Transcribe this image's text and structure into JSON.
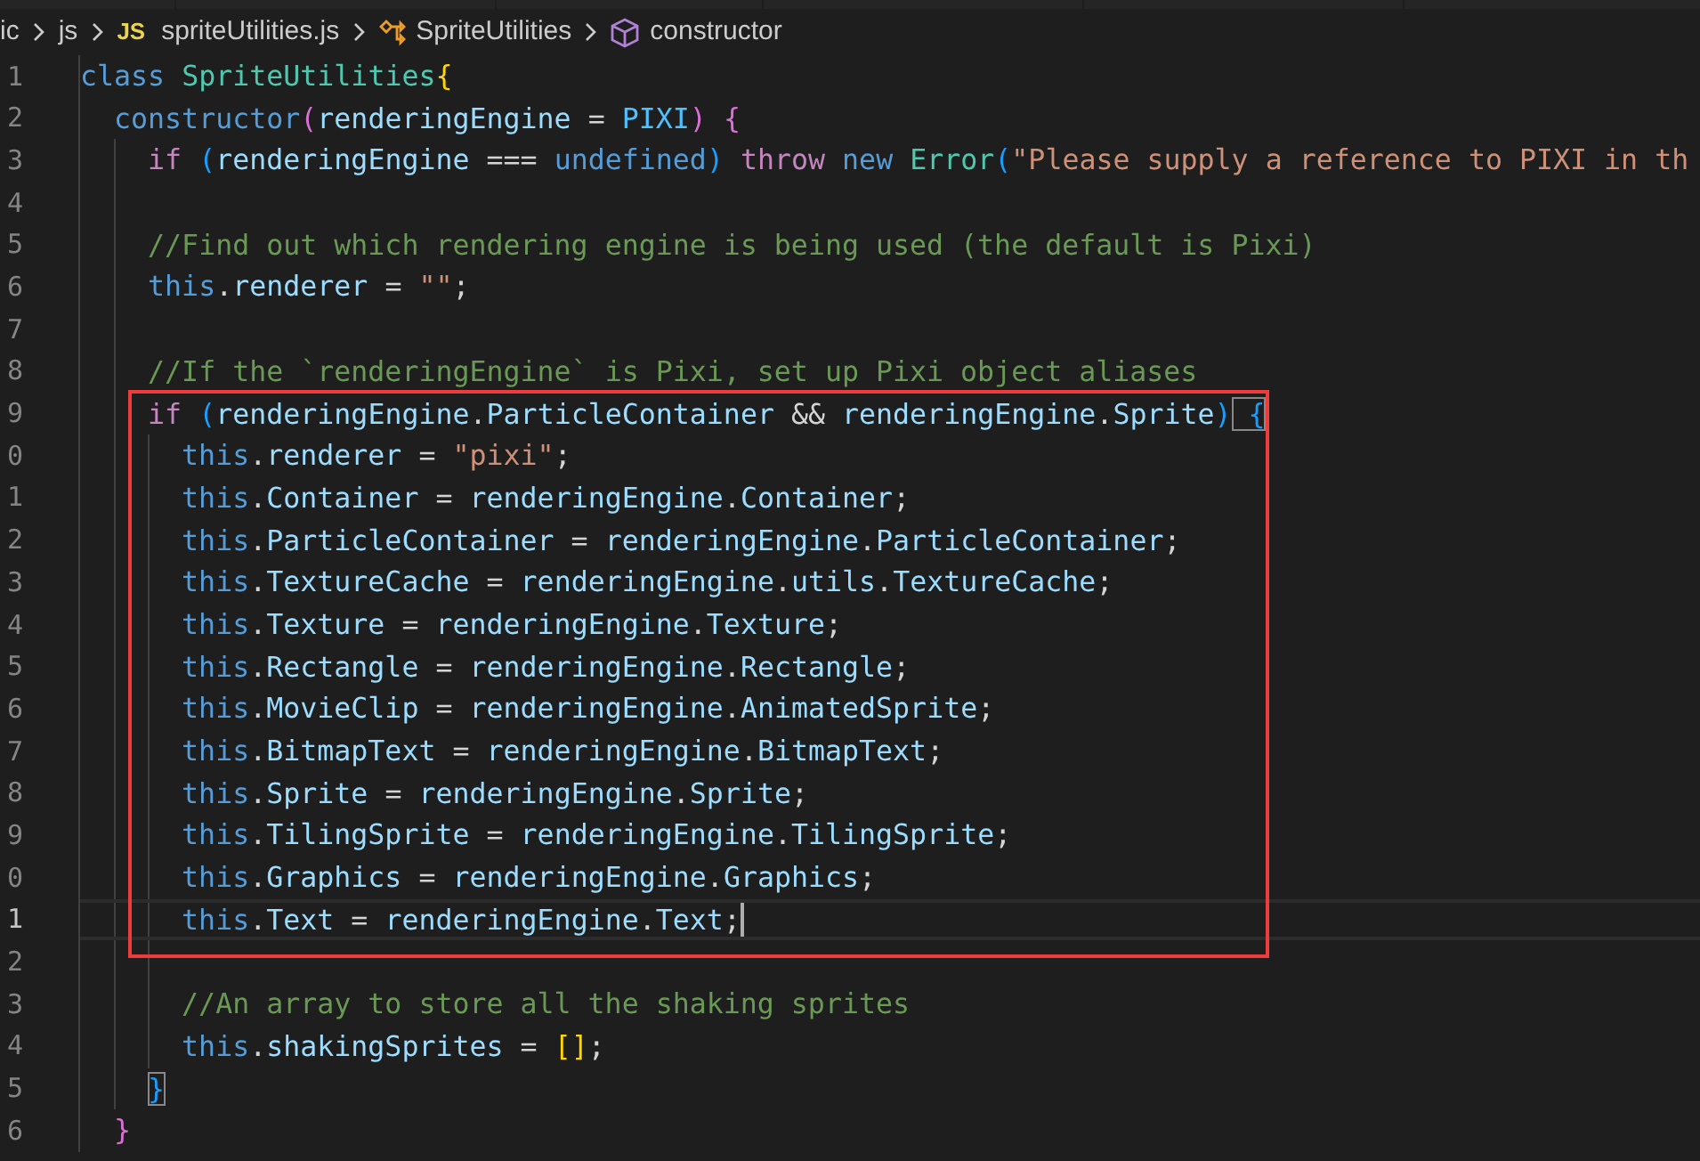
{
  "breadcrumb": {
    "segments": [
      {
        "kind": "folder",
        "text": "ic"
      },
      {
        "kind": "folder",
        "text": "js"
      },
      {
        "kind": "file",
        "badge": "JS",
        "text": "spriteUtilities.js"
      },
      {
        "kind": "class",
        "text": "SpriteUtilities"
      },
      {
        "kind": "method",
        "text": "constructor"
      }
    ]
  },
  "editor": {
    "lines": [
      {
        "number": "1",
        "current": false,
        "tokens": [
          {
            "kind": "kw",
            "text": "class"
          },
          {
            "kind": "cls",
            "text": " SpriteUtilities"
          },
          {
            "kind": "b1",
            "text": "{",
            "matched": false
          }
        ]
      },
      {
        "number": "2",
        "current": false,
        "tokens": [
          {
            "kind": "kw",
            "text": "  constructor"
          },
          {
            "kind": "b2",
            "text": "(",
            "matched": false
          },
          {
            "kind": "var",
            "text": "renderingEngine"
          },
          {
            "kind": "op",
            "text": " = "
          },
          {
            "kind": "const",
            "text": "PIXI"
          },
          {
            "kind": "b2",
            "text": ")",
            "matched": false
          },
          {
            "kind": "b2",
            "text": " {",
            "matched": false
          }
        ]
      },
      {
        "number": "3",
        "current": false,
        "tokens": [
          {
            "kind": "ctl",
            "text": "    if"
          },
          {
            "kind": "b3",
            "text": " (",
            "matched": false
          },
          {
            "kind": "var",
            "text": "renderingEngine"
          },
          {
            "kind": "op",
            "text": " === "
          },
          {
            "kind": "kw",
            "text": "undefined"
          },
          {
            "kind": "b3",
            "text": ")",
            "matched": false
          },
          {
            "kind": "ctl",
            "text": " throw"
          },
          {
            "kind": "kw",
            "text": " new"
          },
          {
            "kind": "cls",
            "text": " Error"
          },
          {
            "kind": "b3",
            "text": "(",
            "matched": false
          },
          {
            "kind": "str",
            "text": "\"Please supply a reference to PIXI in th"
          }
        ]
      },
      {
        "number": "4",
        "current": false
      },
      {
        "number": "5",
        "current": false,
        "tokens": [
          {
            "kind": "cmt",
            "text": "    //Find out which rendering engine is being used (the default is Pixi)"
          }
        ]
      },
      {
        "number": "6",
        "current": false,
        "tokens": [
          {
            "kind": "kw",
            "text": "    this"
          },
          {
            "kind": "op",
            "text": "."
          },
          {
            "kind": "var",
            "text": "renderer"
          },
          {
            "kind": "op",
            "text": " = "
          },
          {
            "kind": "str",
            "text": "\"\""
          },
          {
            "kind": "op",
            "text": ";"
          }
        ]
      },
      {
        "number": "7",
        "current": false
      },
      {
        "number": "8",
        "current": false,
        "tokens": [
          {
            "kind": "cmt",
            "text": "    //If the `renderingEngine` is Pixi, set up Pixi object aliases"
          }
        ]
      },
      {
        "number": "9",
        "current": false,
        "tokens": [
          {
            "kind": "ctl",
            "text": "    if"
          },
          {
            "kind": "b3",
            "text": " (",
            "matched": false
          },
          {
            "kind": "var",
            "text": "renderingEngine"
          },
          {
            "kind": "op",
            "text": "."
          },
          {
            "kind": "var",
            "text": "ParticleContainer"
          },
          {
            "kind": "op",
            "text": " && "
          },
          {
            "kind": "var",
            "text": "renderingEngine"
          },
          {
            "kind": "op",
            "text": "."
          },
          {
            "kind": "var",
            "text": "Sprite"
          },
          {
            "kind": "b3",
            "text": ")",
            "matched": false
          },
          {
            "kind": "b3",
            "text": " {",
            "matched": true
          }
        ]
      },
      {
        "number": "0",
        "current": false,
        "tokens": [
          {
            "kind": "kw",
            "text": "      this"
          },
          {
            "kind": "op",
            "text": "."
          },
          {
            "kind": "var",
            "text": "renderer"
          },
          {
            "kind": "op",
            "text": " = "
          },
          {
            "kind": "str",
            "text": "\"pixi\""
          },
          {
            "kind": "op",
            "text": ";"
          }
        ]
      },
      {
        "number": "1",
        "current": false,
        "tokens": [
          {
            "kind": "kw",
            "text": "      this"
          },
          {
            "kind": "op",
            "text": "."
          },
          {
            "kind": "var",
            "text": "Container"
          },
          {
            "kind": "op",
            "text": " = "
          },
          {
            "kind": "var",
            "text": "renderingEngine"
          },
          {
            "kind": "op",
            "text": "."
          },
          {
            "kind": "var",
            "text": "Container"
          },
          {
            "kind": "op",
            "text": ";"
          }
        ]
      },
      {
        "number": "2",
        "current": false,
        "tokens": [
          {
            "kind": "kw",
            "text": "      this"
          },
          {
            "kind": "op",
            "text": "."
          },
          {
            "kind": "var",
            "text": "ParticleContainer"
          },
          {
            "kind": "op",
            "text": " = "
          },
          {
            "kind": "var",
            "text": "renderingEngine"
          },
          {
            "kind": "op",
            "text": "."
          },
          {
            "kind": "var",
            "text": "ParticleContainer"
          },
          {
            "kind": "op",
            "text": ";"
          }
        ]
      },
      {
        "number": "3",
        "current": false,
        "tokens": [
          {
            "kind": "kw",
            "text": "      this"
          },
          {
            "kind": "op",
            "text": "."
          },
          {
            "kind": "var",
            "text": "TextureCache"
          },
          {
            "kind": "op",
            "text": " = "
          },
          {
            "kind": "var",
            "text": "renderingEngine"
          },
          {
            "kind": "op",
            "text": "."
          },
          {
            "kind": "var",
            "text": "utils"
          },
          {
            "kind": "op",
            "text": "."
          },
          {
            "kind": "var",
            "text": "TextureCache"
          },
          {
            "kind": "op",
            "text": ";"
          }
        ]
      },
      {
        "number": "4",
        "current": false,
        "tokens": [
          {
            "kind": "kw",
            "text": "      this"
          },
          {
            "kind": "op",
            "text": "."
          },
          {
            "kind": "var",
            "text": "Texture"
          },
          {
            "kind": "op",
            "text": " = "
          },
          {
            "kind": "var",
            "text": "renderingEngine"
          },
          {
            "kind": "op",
            "text": "."
          },
          {
            "kind": "var",
            "text": "Texture"
          },
          {
            "kind": "op",
            "text": ";"
          }
        ]
      },
      {
        "number": "5",
        "current": false,
        "tokens": [
          {
            "kind": "kw",
            "text": "      this"
          },
          {
            "kind": "op",
            "text": "."
          },
          {
            "kind": "var",
            "text": "Rectangle"
          },
          {
            "kind": "op",
            "text": " = "
          },
          {
            "kind": "var",
            "text": "renderingEngine"
          },
          {
            "kind": "op",
            "text": "."
          },
          {
            "kind": "var",
            "text": "Rectangle"
          },
          {
            "kind": "op",
            "text": ";"
          }
        ]
      },
      {
        "number": "6",
        "current": false,
        "tokens": [
          {
            "kind": "kw",
            "text": "      this"
          },
          {
            "kind": "op",
            "text": "."
          },
          {
            "kind": "var",
            "text": "MovieClip"
          },
          {
            "kind": "op",
            "text": " = "
          },
          {
            "kind": "var",
            "text": "renderingEngine"
          },
          {
            "kind": "op",
            "text": "."
          },
          {
            "kind": "var",
            "text": "AnimatedSprite"
          },
          {
            "kind": "op",
            "text": ";"
          }
        ]
      },
      {
        "number": "7",
        "current": false,
        "tokens": [
          {
            "kind": "kw",
            "text": "      this"
          },
          {
            "kind": "op",
            "text": "."
          },
          {
            "kind": "var",
            "text": "BitmapText"
          },
          {
            "kind": "op",
            "text": " = "
          },
          {
            "kind": "var",
            "text": "renderingEngine"
          },
          {
            "kind": "op",
            "text": "."
          },
          {
            "kind": "var",
            "text": "BitmapText"
          },
          {
            "kind": "op",
            "text": ";"
          }
        ]
      },
      {
        "number": "8",
        "current": false,
        "tokens": [
          {
            "kind": "kw",
            "text": "      this"
          },
          {
            "kind": "op",
            "text": "."
          },
          {
            "kind": "var",
            "text": "Sprite"
          },
          {
            "kind": "op",
            "text": " = "
          },
          {
            "kind": "var",
            "text": "renderingEngine"
          },
          {
            "kind": "op",
            "text": "."
          },
          {
            "kind": "var",
            "text": "Sprite"
          },
          {
            "kind": "op",
            "text": ";"
          }
        ]
      },
      {
        "number": "9",
        "current": false,
        "tokens": [
          {
            "kind": "kw",
            "text": "      this"
          },
          {
            "kind": "op",
            "text": "."
          },
          {
            "kind": "var",
            "text": "TilingSprite"
          },
          {
            "kind": "op",
            "text": " = "
          },
          {
            "kind": "var",
            "text": "renderingEngine"
          },
          {
            "kind": "op",
            "text": "."
          },
          {
            "kind": "var",
            "text": "TilingSprite"
          },
          {
            "kind": "op",
            "text": ";"
          }
        ]
      },
      {
        "number": "0",
        "current": false,
        "tokens": [
          {
            "kind": "kw",
            "text": "      this"
          },
          {
            "kind": "op",
            "text": "."
          },
          {
            "kind": "var",
            "text": "Graphics"
          },
          {
            "kind": "op",
            "text": " = "
          },
          {
            "kind": "var",
            "text": "renderingEngine"
          },
          {
            "kind": "op",
            "text": "."
          },
          {
            "kind": "var",
            "text": "Graphics"
          },
          {
            "kind": "op",
            "text": ";"
          }
        ]
      },
      {
        "number": "1",
        "current": true,
        "tokens": [
          {
            "kind": "kw",
            "text": "      this"
          },
          {
            "kind": "op",
            "text": "."
          },
          {
            "kind": "var",
            "text": "Text"
          },
          {
            "kind": "op",
            "text": " = "
          },
          {
            "kind": "var",
            "text": "renderingEngine"
          },
          {
            "kind": "op",
            "text": "."
          },
          {
            "kind": "var",
            "text": "Text"
          },
          {
            "kind": "op",
            "text": ";"
          }
        ]
      },
      {
        "number": "2",
        "current": false
      },
      {
        "number": "3",
        "current": false,
        "tokens": [
          {
            "kind": "cmt",
            "text": "      //An array to store all the shaking sprites"
          }
        ]
      },
      {
        "number": "4",
        "current": false,
        "tokens": [
          {
            "kind": "kw",
            "text": "      this"
          },
          {
            "kind": "op",
            "text": "."
          },
          {
            "kind": "var",
            "text": "shakingSprites"
          },
          {
            "kind": "op",
            "text": " = "
          },
          {
            "kind": "b1",
            "text": "[]",
            "matched": false
          },
          {
            "kind": "op",
            "text": ";"
          }
        ]
      },
      {
        "number": "5",
        "current": false,
        "tokens": [
          {
            "kind": "b3",
            "text": "    }",
            "matched": true
          }
        ]
      },
      {
        "number": "6",
        "current": false,
        "tokens": [
          {
            "kind": "b2",
            "text": "  }",
            "matched": false
          }
        ]
      }
    ]
  }
}
